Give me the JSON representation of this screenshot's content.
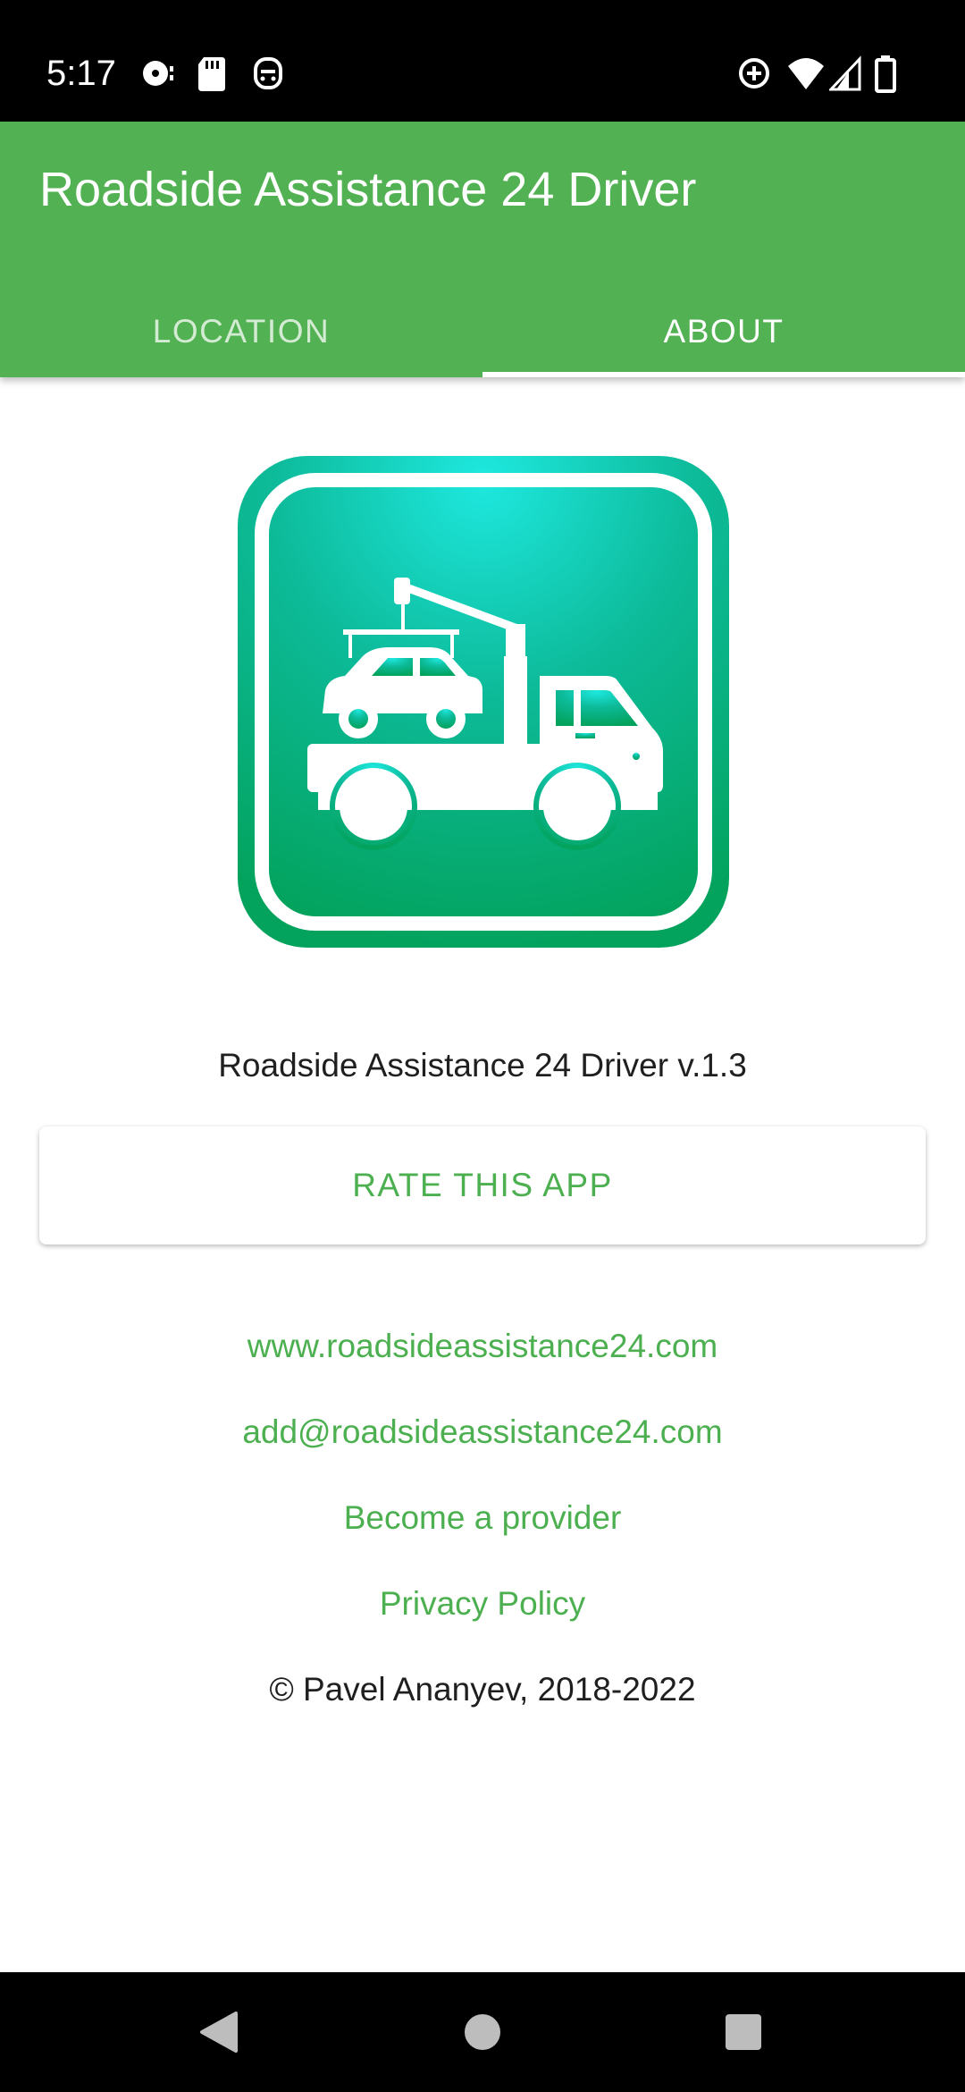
{
  "status_bar": {
    "time": "5:17",
    "left_icons": [
      "media-icon",
      "sd-card-icon",
      "game-controller-icon"
    ],
    "right_icons": [
      "data-saver-icon",
      "wifi-icon",
      "signal-icon",
      "battery-icon"
    ]
  },
  "app_bar": {
    "title": "Roadside Assistance 24 Driver",
    "color": "#52b152"
  },
  "tabs": [
    {
      "label": "LOCATION",
      "selected": false
    },
    {
      "label": "ABOUT",
      "selected": true
    }
  ],
  "about": {
    "logo_icon": "tow-truck-icon",
    "version_text": "Roadside Assistance 24 Driver v.1.3",
    "rate_button": "RATE THIS APP",
    "links": {
      "website": "www.roadsideassistance24.com",
      "email": "add@roadsideassistance24.com",
      "provider": "Become a provider",
      "privacy": "Privacy Policy"
    },
    "copyright": "© Pavel Ananyev, 2018-2022",
    "accent_color": "#4caf50"
  },
  "nav_bar": {
    "buttons": [
      "back-icon",
      "home-icon",
      "recents-icon"
    ]
  }
}
